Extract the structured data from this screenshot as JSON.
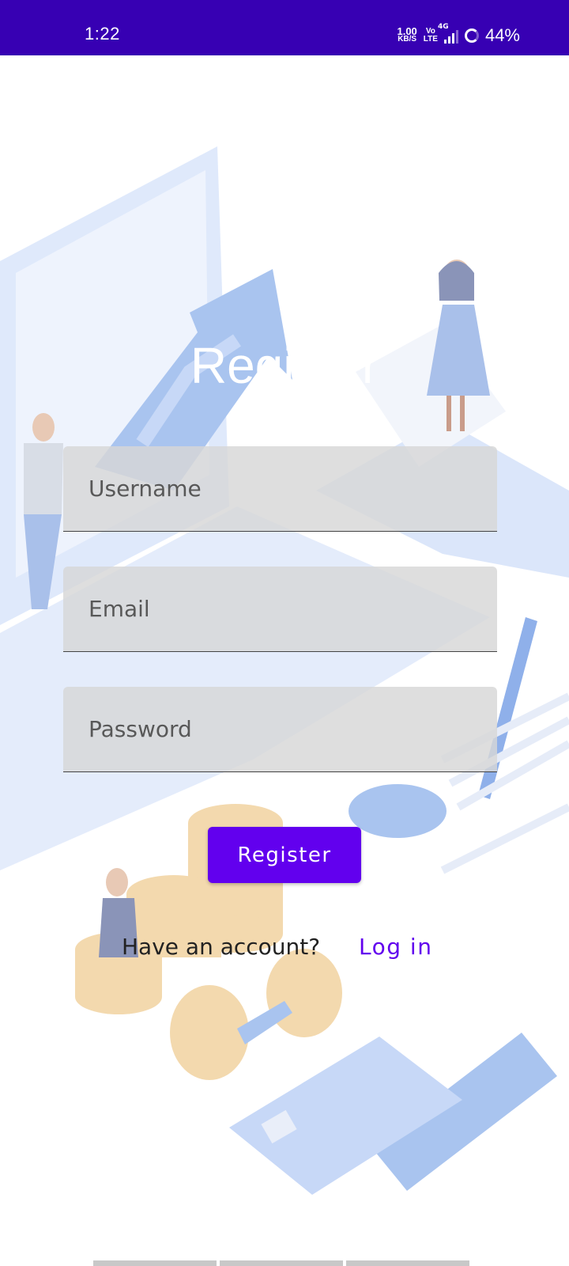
{
  "status_bar": {
    "time": "1:22",
    "net_speed_value": "1.00",
    "net_speed_unit": "KB/S",
    "volte_top": "Vo",
    "volte_bottom": "LTE",
    "network": "4G",
    "battery": "44%",
    "background": "#3700b3"
  },
  "screen": {
    "title": "Register",
    "username_placeholder": "Username",
    "email_placeholder": "Email",
    "password_placeholder": "Password",
    "register_label": "Register",
    "have_account_text": "Have an account?",
    "login_label": "Log in",
    "accent": "#6200ee"
  },
  "icons": [
    "signal-icon",
    "battery-icon"
  ]
}
